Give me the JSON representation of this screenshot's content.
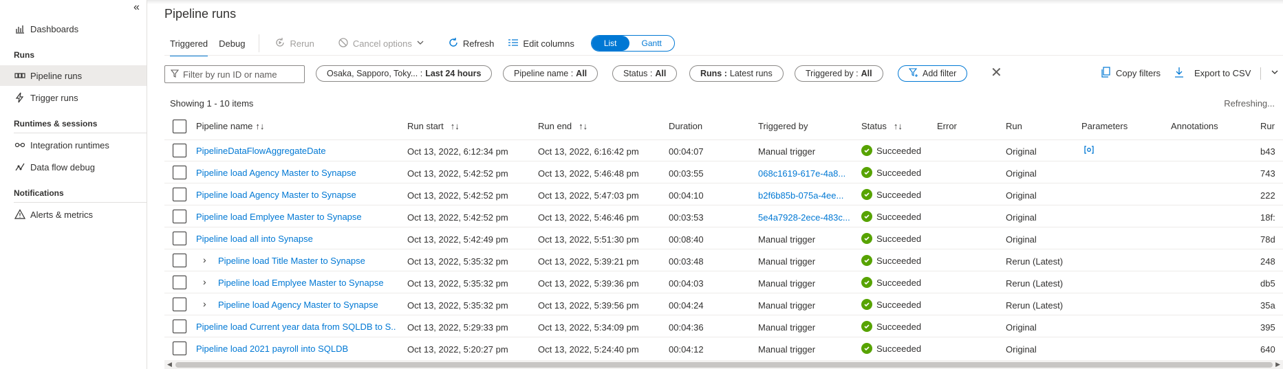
{
  "sidebar": {
    "collapse_glyph": "«",
    "dashboards": "Dashboards",
    "section_runs": "Runs",
    "pipeline_runs": "Pipeline runs",
    "trigger_runs": "Trigger runs",
    "section_runtimes": "Runtimes & sessions",
    "integration_runtimes": "Integration runtimes",
    "data_flow_debug": "Data flow debug",
    "section_notifications": "Notifications",
    "alerts_metrics": "Alerts & metrics"
  },
  "page": {
    "title": "Pipeline runs"
  },
  "toolbar": {
    "tab_triggered": "Triggered",
    "tab_debug": "Debug",
    "rerun": "Rerun",
    "cancel_options": "Cancel options",
    "refresh": "Refresh",
    "edit_columns": "Edit columns",
    "view_list": "List",
    "view_gantt": "Gantt"
  },
  "filters": {
    "search_placeholder": "Filter by run ID or name",
    "timezone_prefix": "Osaka, Sapporo, Toky... :",
    "timezone_value": "Last 24 hours",
    "pipeline_name_prefix": "Pipeline name :",
    "pipeline_name_value": "All",
    "status_prefix": "Status :",
    "status_value": "All",
    "runs_prefix": "Runs :",
    "runs_value": "Latest runs",
    "triggered_by_prefix": "Triggered by :",
    "triggered_by_value": "All",
    "add_filter": "Add filter",
    "copy_filters": "Copy filters",
    "export_csv": "Export to CSV"
  },
  "table": {
    "showing": "Showing 1 - 10 items",
    "refreshing": "Refreshing...",
    "columns": {
      "pipeline_name": "Pipeline name",
      "run_start": "Run start",
      "run_end": "Run end",
      "duration": "Duration",
      "triggered_by": "Triggered by",
      "status": "Status",
      "error": "Error",
      "run": "Run",
      "parameters": "Parameters",
      "annotations": "Annotations",
      "run_id": "Rur"
    },
    "rows": [
      {
        "name": "PipelineDataFlowAggregateDate",
        "start": "Oct 13, 2022, 6:12:34 pm",
        "end": "Oct 13, 2022, 6:16:42 pm",
        "duration": "00:04:07",
        "trig": "Manual trigger",
        "status": "Succeeded",
        "run": "Original",
        "runid": "b43"
      },
      {
        "name": "Pipeline load Agency Master to Synapse",
        "start": "Oct 13, 2022, 5:42:52 pm",
        "end": "Oct 13, 2022, 5:46:48 pm",
        "duration": "00:03:55",
        "trig": "068c1619-617e-4a8...",
        "status": "Succeeded",
        "run": "Original",
        "runid": "743"
      },
      {
        "name": "Pipeline load Agency Master to Synapse",
        "start": "Oct 13, 2022, 5:42:52 pm",
        "end": "Oct 13, 2022, 5:47:03 pm",
        "duration": "00:04:10",
        "trig": "b2f6b85b-075a-4ee...",
        "status": "Succeeded",
        "run": "Original",
        "runid": "222"
      },
      {
        "name": "Pipeline load Emplyee Master to Synapse",
        "start": "Oct 13, 2022, 5:42:52 pm",
        "end": "Oct 13, 2022, 5:46:46 pm",
        "duration": "00:03:53",
        "trig": "5e4a7928-2ece-483c...",
        "status": "Succeeded",
        "run": "Original",
        "runid": "18f:"
      },
      {
        "name": "Pipeline load all into Synapse",
        "start": "Oct 13, 2022, 5:42:49 pm",
        "end": "Oct 13, 2022, 5:51:30 pm",
        "duration": "00:08:40",
        "trig": "Manual trigger",
        "status": "Succeeded",
        "run": "Original",
        "runid": "78d"
      },
      {
        "name": "Pipeline load Title Master to Synapse",
        "start": "Oct 13, 2022, 5:35:32 pm",
        "end": "Oct 13, 2022, 5:39:21 pm",
        "duration": "00:03:48",
        "trig": "Manual trigger",
        "status": "Succeeded",
        "run": "Rerun (Latest)",
        "runid": "248"
      },
      {
        "name": "Pipeline load Emplyee Master to Synapse",
        "start": "Oct 13, 2022, 5:35:32 pm",
        "end": "Oct 13, 2022, 5:39:36 pm",
        "duration": "00:04:03",
        "trig": "Manual trigger",
        "status": "Succeeded",
        "run": "Rerun (Latest)",
        "runid": "db5"
      },
      {
        "name": "Pipeline load Agency Master to Synapse",
        "start": "Oct 13, 2022, 5:35:32 pm",
        "end": "Oct 13, 2022, 5:39:56 pm",
        "duration": "00:04:24",
        "trig": "Manual trigger",
        "status": "Succeeded",
        "run": "Rerun (Latest)",
        "runid": "35a"
      },
      {
        "name": "Pipeline load Current year data from SQLDB to S...",
        "start": "Oct 13, 2022, 5:29:33 pm",
        "end": "Oct 13, 2022, 5:34:09 pm",
        "duration": "00:04:36",
        "trig": "Manual trigger",
        "status": "Succeeded",
        "run": "Original",
        "runid": "395"
      },
      {
        "name": "Pipeline load 2021 payroll into SQLDB",
        "start": "Oct 13, 2022, 5:20:27 pm",
        "end": "Oct 13, 2022, 5:24:40 pm",
        "duration": "00:04:12",
        "trig": "Manual trigger",
        "status": "Succeeded",
        "run": "Original",
        "runid": "640"
      }
    ]
  },
  "colors": {
    "accent": "#0078d4",
    "success": "#57a300"
  }
}
